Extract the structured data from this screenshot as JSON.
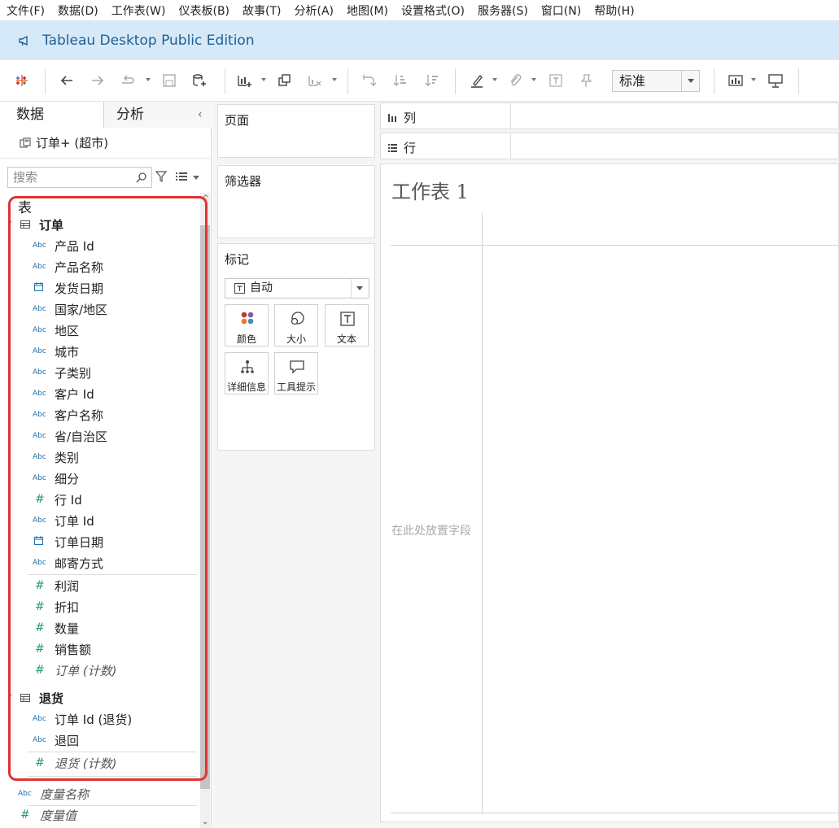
{
  "menu": [
    "文件(F)",
    "数据(D)",
    "工作表(W)",
    "仪表板(B)",
    "故事(T)",
    "分析(A)",
    "地图(M)",
    "设置格式(O)",
    "服务器(S)",
    "窗口(N)",
    "帮助(H)"
  ],
  "app_title": "Tableau Desktop Public Edition",
  "toolbar": {
    "zoom_value": "标准",
    "icons": [
      "tableau-logo-icon",
      "back-icon",
      "forward-icon",
      "redo-icon",
      "save-icon",
      "new-datasource-icon",
      "new-worksheet-icon",
      "duplicate-icon",
      "clear-icon",
      "swap-icon",
      "sort-asc-icon",
      "sort-desc-icon",
      "highlight-icon",
      "attach-icon",
      "label-icon",
      "pin-icon",
      "show-me-icon",
      "presentation-icon"
    ]
  },
  "data_pane": {
    "tab_data": "数据",
    "tab_analytics": "分析",
    "datasource": "订单+ (超市)",
    "search_placeholder": "搜索",
    "tables_heading": "表",
    "tables": [
      {
        "name": "订单",
        "dimensions": [
          {
            "type": "Abc",
            "label": "产品 Id"
          },
          {
            "type": "Abc",
            "label": "产品名称"
          },
          {
            "type": "date",
            "label": "发货日期"
          },
          {
            "type": "Abc",
            "label": "国家/地区"
          },
          {
            "type": "Abc",
            "label": "地区"
          },
          {
            "type": "Abc",
            "label": "城市"
          },
          {
            "type": "Abc",
            "label": "子类别"
          },
          {
            "type": "Abc",
            "label": "客户 Id"
          },
          {
            "type": "Abc",
            "label": "客户名称"
          },
          {
            "type": "Abc",
            "label": "省/自治区"
          },
          {
            "type": "Abc",
            "label": "类别"
          },
          {
            "type": "Abc",
            "label": "细分"
          },
          {
            "type": "#",
            "label": "行 Id"
          },
          {
            "type": "Abc",
            "label": "订单 Id"
          },
          {
            "type": "date",
            "label": "订单日期"
          },
          {
            "type": "Abc",
            "label": "邮寄方式"
          }
        ],
        "measures": [
          {
            "type": "#",
            "label": "利润"
          },
          {
            "type": "#",
            "label": "折扣"
          },
          {
            "type": "#",
            "label": "数量"
          },
          {
            "type": "#",
            "label": "销售额"
          },
          {
            "type": "#",
            "label": "订单 (计数)",
            "italic": true
          }
        ]
      },
      {
        "name": "退货",
        "dimensions": [
          {
            "type": "Abc",
            "label": "订单 Id (退货)"
          },
          {
            "type": "Abc",
            "label": "退回"
          }
        ],
        "measures": [
          {
            "type": "#",
            "label": "退货 (计数)",
            "italic": true
          }
        ]
      }
    ],
    "extra_fields": [
      {
        "type": "Abc",
        "label": "度量名称"
      },
      {
        "type": "#",
        "label": "度量值"
      }
    ],
    "highlight_color": "#e03434"
  },
  "shelves": {
    "pages": "页面",
    "filters": "筛选器",
    "marks": "标记",
    "mark_type": "自动",
    "mark_buttons": {
      "color": "颜色",
      "size": "大小",
      "text": "文本",
      "detail": "详细信息",
      "tooltip": "工具提示"
    },
    "columns": "列",
    "rows": "行"
  },
  "sheet": {
    "title": "工作表 1",
    "drop_hint": "在此处放置字段"
  },
  "colors": {
    "title_bar_bg": "#d6e9f8",
    "title_text": "#1f5f93",
    "dimension_icon": "#1f6fa8",
    "measure_icon": "#2a9b72"
  }
}
